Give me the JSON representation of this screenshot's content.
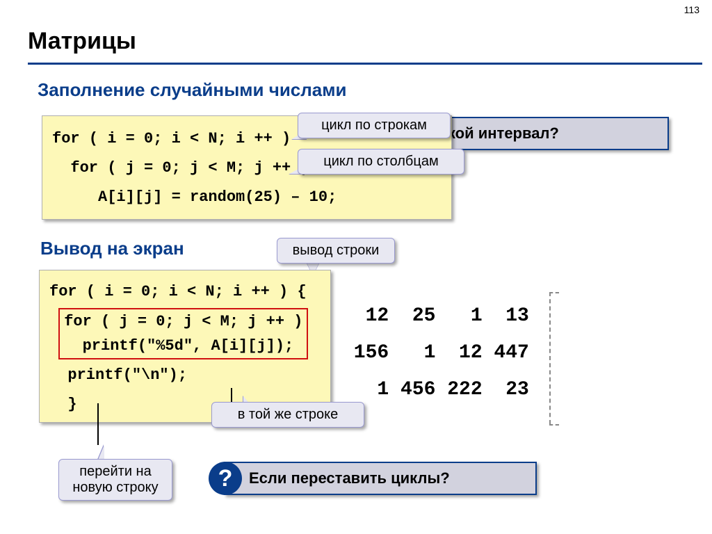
{
  "page_number": "113",
  "title": "Матрицы",
  "section1": "Заполнение случайными числами",
  "section2": "Вывод на экран",
  "code1": {
    "line1": "for ( i = 0; i < N; i ++ )",
    "line2": "  for ( j = 0; j < M; j ++ )",
    "line3": "     A[i][j] = random(25) – 10;"
  },
  "code2": {
    "line1": "for ( i = 0; i < N; i ++ ) {",
    "inner1": "for ( j = 0; j < M; j ++ )",
    "inner2": "  printf(\"%5d\", A[i][j]);",
    "line4": "  printf(\"\\n\");",
    "line5": "  }"
  },
  "callouts": {
    "rows": "цикл по строкам",
    "cols": "цикл по столбцам",
    "out_row": "вывод строки",
    "same_line": "в той же строке",
    "newline": "перейти на новую строку"
  },
  "questions": {
    "interval": "Какой интервал?",
    "swap": "Если переставить циклы?"
  },
  "matrix_rows": [
    "  12  25   1  13",
    " 156   1  12 447",
    "   1 456 222  23"
  ]
}
